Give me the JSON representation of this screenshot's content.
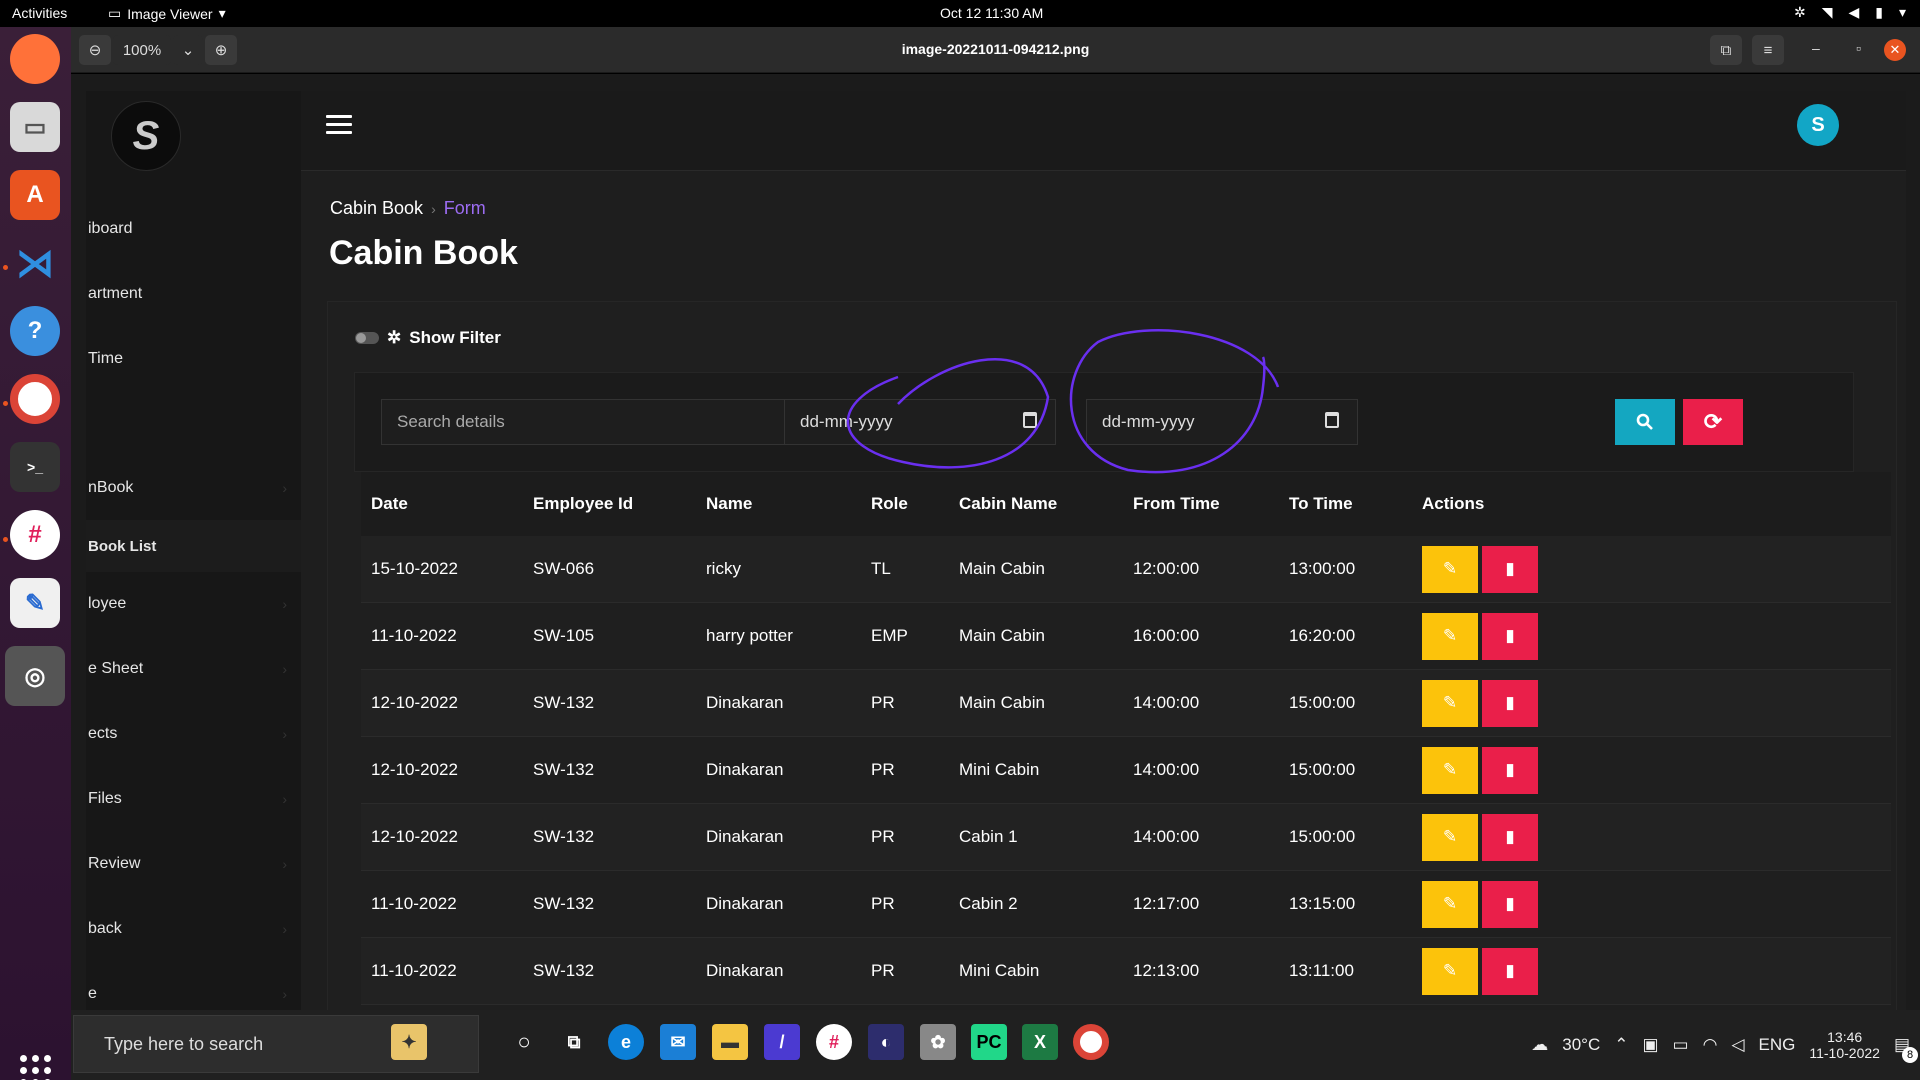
{
  "topbar": {
    "activities": "Activities",
    "app_name": "Image Viewer",
    "clock": "Oct 12  11:30 AM"
  },
  "viewer": {
    "zoom": "100%",
    "filename": "image-20221011-094212.png"
  },
  "app": {
    "logo_letter": "S",
    "avatar_letter": "S",
    "sidebar": [
      {
        "label": "iboard"
      },
      {
        "label": "artment"
      },
      {
        "label": "Time"
      },
      {
        "label": "nBook"
      },
      {
        "label": "Book List"
      },
      {
        "label": "loyee"
      },
      {
        "label": "e Sheet"
      },
      {
        "label": "ects"
      },
      {
        "label": "Files"
      },
      {
        "label": "Review"
      },
      {
        "label": "back"
      },
      {
        "label": "e"
      }
    ],
    "breadcrumb": {
      "parent": "Cabin Book",
      "current": "Form"
    },
    "page_title": "Cabin Book",
    "filter": {
      "toggle_label": "Show Filter",
      "search_placeholder": "Search details",
      "from_date_placeholder": "dd-mm-yyyy",
      "to_date_placeholder": "dd-mm-yyyy"
    },
    "table": {
      "columns": [
        "Date",
        "Employee Id",
        "Name",
        "Role",
        "Cabin Name",
        "From Time",
        "To Time",
        "Actions"
      ],
      "rows": [
        {
          "date": "15-10-2022",
          "emp": "SW-066",
          "name": "ricky",
          "role": "TL",
          "cabin": "Main Cabin",
          "from": "12:00:00",
          "to": "13:00:00"
        },
        {
          "date": "11-10-2022",
          "emp": "SW-105",
          "name": "harry potter",
          "role": "EMP",
          "cabin": "Main Cabin",
          "from": "16:00:00",
          "to": "16:20:00"
        },
        {
          "date": "12-10-2022",
          "emp": "SW-132",
          "name": "Dinakaran",
          "role": "PR",
          "cabin": "Main Cabin",
          "from": "14:00:00",
          "to": "15:00:00"
        },
        {
          "date": "12-10-2022",
          "emp": "SW-132",
          "name": "Dinakaran",
          "role": "PR",
          "cabin": "Mini Cabin",
          "from": "14:00:00",
          "to": "15:00:00"
        },
        {
          "date": "12-10-2022",
          "emp": "SW-132",
          "name": "Dinakaran",
          "role": "PR",
          "cabin": "Cabin 1",
          "from": "14:00:00",
          "to": "15:00:00"
        },
        {
          "date": "11-10-2022",
          "emp": "SW-132",
          "name": "Dinakaran",
          "role": "PR",
          "cabin": "Cabin 2",
          "from": "12:17:00",
          "to": "13:15:00"
        },
        {
          "date": "11-10-2022",
          "emp": "SW-132",
          "name": "Dinakaran",
          "role": "PR",
          "cabin": "Mini Cabin",
          "from": "12:13:00",
          "to": "13:11:00"
        }
      ]
    }
  },
  "windows_taskbar": {
    "search_placeholder": "Type here to search",
    "weather": "30°C",
    "language": "ENG",
    "time": "13:46",
    "date": "11-10-2022",
    "notification_count": "8"
  },
  "colors": {
    "accent_search": "#14a7c1",
    "accent_danger": "#ea1f4a",
    "accent_edit": "#fcc30b",
    "breadcrumb_active": "#9c6cf2",
    "annotation_pen": "#6a2ff0"
  }
}
